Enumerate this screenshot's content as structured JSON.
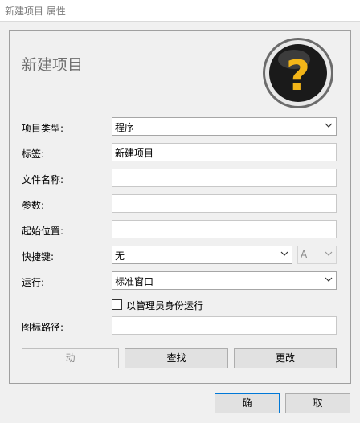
{
  "window": {
    "title": "新建项目 属性"
  },
  "heading": "新建项目",
  "help_icon": "question-mark-icon",
  "fields": {
    "type_label": "项目类型:",
    "type_value": "程序",
    "tag_label": "标签:",
    "tag_value": "新建项目",
    "filename_label": "文件名称:",
    "filename_value": "",
    "params_label": "参数:",
    "params_value": "",
    "startpos_label": "起始位置:",
    "startpos_value": "",
    "hotkey_label": "快捷键:",
    "hotkey_modifier": "无",
    "hotkey_key": "A",
    "run_label": "运行:",
    "run_value": "标准窗口",
    "admin_label": "以管理员身份运行",
    "admin_checked": false,
    "iconpath_label": "图标路径:",
    "iconpath_value": ""
  },
  "buttons": {
    "action": "动",
    "find": "查找",
    "change": "更改",
    "ok": "确",
    "cancel": "取"
  }
}
